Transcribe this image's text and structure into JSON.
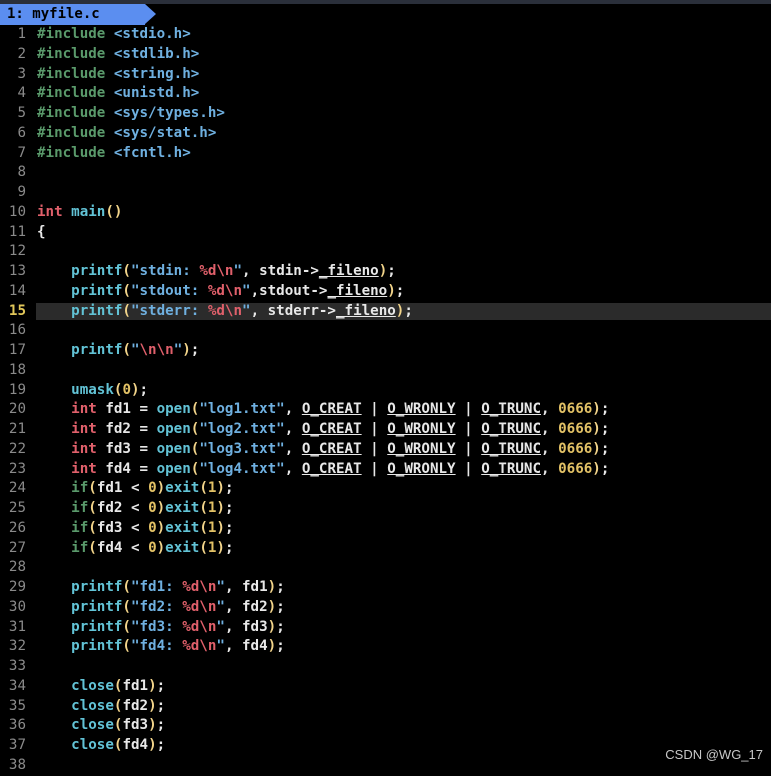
{
  "editor": {
    "tab_label": "1: myfile.c",
    "cursor_line": 15
  },
  "lines": [
    [
      [
        "kw",
        "#include "
      ],
      [
        "str",
        "<stdio.h>"
      ]
    ],
    [
      [
        "kw",
        "#include "
      ],
      [
        "str",
        "<stdlib.h>"
      ]
    ],
    [
      [
        "kw",
        "#include "
      ],
      [
        "str",
        "<string.h>"
      ]
    ],
    [
      [
        "kw",
        "#include "
      ],
      [
        "str",
        "<unistd.h>"
      ]
    ],
    [
      [
        "kw",
        "#include "
      ],
      [
        "str",
        "<sys/types.h>"
      ]
    ],
    [
      [
        "kw",
        "#include "
      ],
      [
        "str",
        "<sys/stat.h>"
      ]
    ],
    [
      [
        "kw",
        "#include "
      ],
      [
        "str",
        "<fcntl.h>"
      ]
    ],
    [],
    [],
    [
      [
        "type",
        "int "
      ],
      [
        "fn",
        "main"
      ],
      [
        "paren",
        "()"
      ]
    ],
    [
      [
        "norm",
        "{"
      ]
    ],
    [],
    [
      [
        "norm",
        "    "
      ],
      [
        "fn",
        "printf"
      ],
      [
        "paren",
        "("
      ],
      [
        "str",
        "\"stdin: "
      ],
      [
        "esc",
        "%d\\n"
      ],
      [
        "str",
        "\""
      ],
      [
        "norm",
        ", stdin->"
      ],
      [
        "member",
        "_fileno"
      ],
      [
        "paren",
        ")"
      ],
      [
        "norm",
        ";"
      ]
    ],
    [
      [
        "norm",
        "    "
      ],
      [
        "fn",
        "printf"
      ],
      [
        "paren",
        "("
      ],
      [
        "str",
        "\"stdout: "
      ],
      [
        "esc",
        "%d\\n"
      ],
      [
        "str",
        "\""
      ],
      [
        "norm",
        ",stdout->"
      ],
      [
        "member",
        "_fileno"
      ],
      [
        "paren",
        ")"
      ],
      [
        "norm",
        ";"
      ]
    ],
    [
      [
        "norm",
        "    "
      ],
      [
        "fn",
        "printf"
      ],
      [
        "paren",
        "("
      ],
      [
        "str",
        "\"stderr: "
      ],
      [
        "esc",
        "%d\\n"
      ],
      [
        "str",
        "\""
      ],
      [
        "norm",
        ", stderr->"
      ],
      [
        "member",
        "_fileno"
      ],
      [
        "paren",
        ")"
      ],
      [
        "norm",
        ";"
      ]
    ],
    [],
    [
      [
        "norm",
        "    "
      ],
      [
        "fn",
        "printf"
      ],
      [
        "paren",
        "("
      ],
      [
        "str",
        "\""
      ],
      [
        "esc",
        "\\n\\n"
      ],
      [
        "str",
        "\""
      ],
      [
        "paren",
        ")"
      ],
      [
        "norm",
        ";"
      ]
    ],
    [],
    [
      [
        "norm",
        "    "
      ],
      [
        "fn",
        "umask"
      ],
      [
        "paren",
        "("
      ],
      [
        "num",
        "0"
      ],
      [
        "paren",
        ")"
      ],
      [
        "norm",
        ";"
      ]
    ],
    [
      [
        "norm",
        "    "
      ],
      [
        "type",
        "int "
      ],
      [
        "norm",
        "fd1 = "
      ],
      [
        "fn",
        "open"
      ],
      [
        "paren",
        "("
      ],
      [
        "str",
        "\"log1.txt\""
      ],
      [
        "norm",
        ", "
      ],
      [
        "member",
        "O_CREAT"
      ],
      [
        "norm",
        " | "
      ],
      [
        "member",
        "O_WRONLY"
      ],
      [
        "norm",
        " | "
      ],
      [
        "member",
        "O_TRUNC"
      ],
      [
        "norm",
        ", "
      ],
      [
        "num",
        "0666"
      ],
      [
        "paren",
        ")"
      ],
      [
        "norm",
        ";"
      ]
    ],
    [
      [
        "norm",
        "    "
      ],
      [
        "type",
        "int "
      ],
      [
        "norm",
        "fd2 = "
      ],
      [
        "fn",
        "open"
      ],
      [
        "paren",
        "("
      ],
      [
        "str",
        "\"log2.txt\""
      ],
      [
        "norm",
        ", "
      ],
      [
        "member",
        "O_CREAT"
      ],
      [
        "norm",
        " | "
      ],
      [
        "member",
        "O_WRONLY"
      ],
      [
        "norm",
        " | "
      ],
      [
        "member",
        "O_TRUNC"
      ],
      [
        "norm",
        ", "
      ],
      [
        "num",
        "0666"
      ],
      [
        "paren",
        ")"
      ],
      [
        "norm",
        ";"
      ]
    ],
    [
      [
        "norm",
        "    "
      ],
      [
        "type",
        "int "
      ],
      [
        "norm",
        "fd3 = "
      ],
      [
        "fn",
        "open"
      ],
      [
        "paren",
        "("
      ],
      [
        "str",
        "\"log3.txt\""
      ],
      [
        "norm",
        ", "
      ],
      [
        "member",
        "O_CREAT"
      ],
      [
        "norm",
        " | "
      ],
      [
        "member",
        "O_WRONLY"
      ],
      [
        "norm",
        " | "
      ],
      [
        "member",
        "O_TRUNC"
      ],
      [
        "norm",
        ", "
      ],
      [
        "num",
        "0666"
      ],
      [
        "paren",
        ")"
      ],
      [
        "norm",
        ";"
      ]
    ],
    [
      [
        "norm",
        "    "
      ],
      [
        "type",
        "int "
      ],
      [
        "norm",
        "fd4 = "
      ],
      [
        "fn",
        "open"
      ],
      [
        "paren",
        "("
      ],
      [
        "str",
        "\"log4.txt\""
      ],
      [
        "norm",
        ", "
      ],
      [
        "member",
        "O_CREAT"
      ],
      [
        "norm",
        " | "
      ],
      [
        "member",
        "O_WRONLY"
      ],
      [
        "norm",
        " | "
      ],
      [
        "member",
        "O_TRUNC"
      ],
      [
        "norm",
        ", "
      ],
      [
        "num",
        "0666"
      ],
      [
        "paren",
        ")"
      ],
      [
        "norm",
        ";"
      ]
    ],
    [
      [
        "norm",
        "    "
      ],
      [
        "kw",
        "if"
      ],
      [
        "paren",
        "("
      ],
      [
        "norm",
        "fd1 < "
      ],
      [
        "num",
        "0"
      ],
      [
        "paren",
        ")"
      ],
      [
        "fn",
        "exit"
      ],
      [
        "paren",
        "("
      ],
      [
        "num",
        "1"
      ],
      [
        "paren",
        ")"
      ],
      [
        "norm",
        ";"
      ]
    ],
    [
      [
        "norm",
        "    "
      ],
      [
        "kw",
        "if"
      ],
      [
        "paren",
        "("
      ],
      [
        "norm",
        "fd2 < "
      ],
      [
        "num",
        "0"
      ],
      [
        "paren",
        ")"
      ],
      [
        "fn",
        "exit"
      ],
      [
        "paren",
        "("
      ],
      [
        "num",
        "1"
      ],
      [
        "paren",
        ")"
      ],
      [
        "norm",
        ";"
      ]
    ],
    [
      [
        "norm",
        "    "
      ],
      [
        "kw",
        "if"
      ],
      [
        "paren",
        "("
      ],
      [
        "norm",
        "fd3 < "
      ],
      [
        "num",
        "0"
      ],
      [
        "paren",
        ")"
      ],
      [
        "fn",
        "exit"
      ],
      [
        "paren",
        "("
      ],
      [
        "num",
        "1"
      ],
      [
        "paren",
        ")"
      ],
      [
        "norm",
        ";"
      ]
    ],
    [
      [
        "norm",
        "    "
      ],
      [
        "kw",
        "if"
      ],
      [
        "paren",
        "("
      ],
      [
        "norm",
        "fd4 < "
      ],
      [
        "num",
        "0"
      ],
      [
        "paren",
        ")"
      ],
      [
        "fn",
        "exit"
      ],
      [
        "paren",
        "("
      ],
      [
        "num",
        "1"
      ],
      [
        "paren",
        ")"
      ],
      [
        "norm",
        ";"
      ]
    ],
    [],
    [
      [
        "norm",
        "    "
      ],
      [
        "fn",
        "printf"
      ],
      [
        "paren",
        "("
      ],
      [
        "str",
        "\"fd1: "
      ],
      [
        "esc",
        "%d\\n"
      ],
      [
        "str",
        "\""
      ],
      [
        "norm",
        ", fd1"
      ],
      [
        "paren",
        ")"
      ],
      [
        "norm",
        ";"
      ]
    ],
    [
      [
        "norm",
        "    "
      ],
      [
        "fn",
        "printf"
      ],
      [
        "paren",
        "("
      ],
      [
        "str",
        "\"fd2: "
      ],
      [
        "esc",
        "%d\\n"
      ],
      [
        "str",
        "\""
      ],
      [
        "norm",
        ", fd2"
      ],
      [
        "paren",
        ")"
      ],
      [
        "norm",
        ";"
      ]
    ],
    [
      [
        "norm",
        "    "
      ],
      [
        "fn",
        "printf"
      ],
      [
        "paren",
        "("
      ],
      [
        "str",
        "\"fd3: "
      ],
      [
        "esc",
        "%d\\n"
      ],
      [
        "str",
        "\""
      ],
      [
        "norm",
        ", fd3"
      ],
      [
        "paren",
        ")"
      ],
      [
        "norm",
        ";"
      ]
    ],
    [
      [
        "norm",
        "    "
      ],
      [
        "fn",
        "printf"
      ],
      [
        "paren",
        "("
      ],
      [
        "str",
        "\"fd4: "
      ],
      [
        "esc",
        "%d\\n"
      ],
      [
        "str",
        "\""
      ],
      [
        "norm",
        ", fd4"
      ],
      [
        "paren",
        ")"
      ],
      [
        "norm",
        ";"
      ]
    ],
    [],
    [
      [
        "norm",
        "    "
      ],
      [
        "fn",
        "close"
      ],
      [
        "paren",
        "("
      ],
      [
        "norm",
        "fd1"
      ],
      [
        "paren",
        ")"
      ],
      [
        "norm",
        ";"
      ]
    ],
    [
      [
        "norm",
        "    "
      ],
      [
        "fn",
        "close"
      ],
      [
        "paren",
        "("
      ],
      [
        "norm",
        "fd2"
      ],
      [
        "paren",
        ")"
      ],
      [
        "norm",
        ";"
      ]
    ],
    [
      [
        "norm",
        "    "
      ],
      [
        "fn",
        "close"
      ],
      [
        "paren",
        "("
      ],
      [
        "norm",
        "fd3"
      ],
      [
        "paren",
        ")"
      ],
      [
        "norm",
        ";"
      ]
    ],
    [
      [
        "norm",
        "    "
      ],
      [
        "fn",
        "close"
      ],
      [
        "paren",
        "("
      ],
      [
        "norm",
        "fd4"
      ],
      [
        "paren",
        ")"
      ],
      [
        "norm",
        ";"
      ]
    ],
    []
  ],
  "watermark": "CSDN @WG_17"
}
